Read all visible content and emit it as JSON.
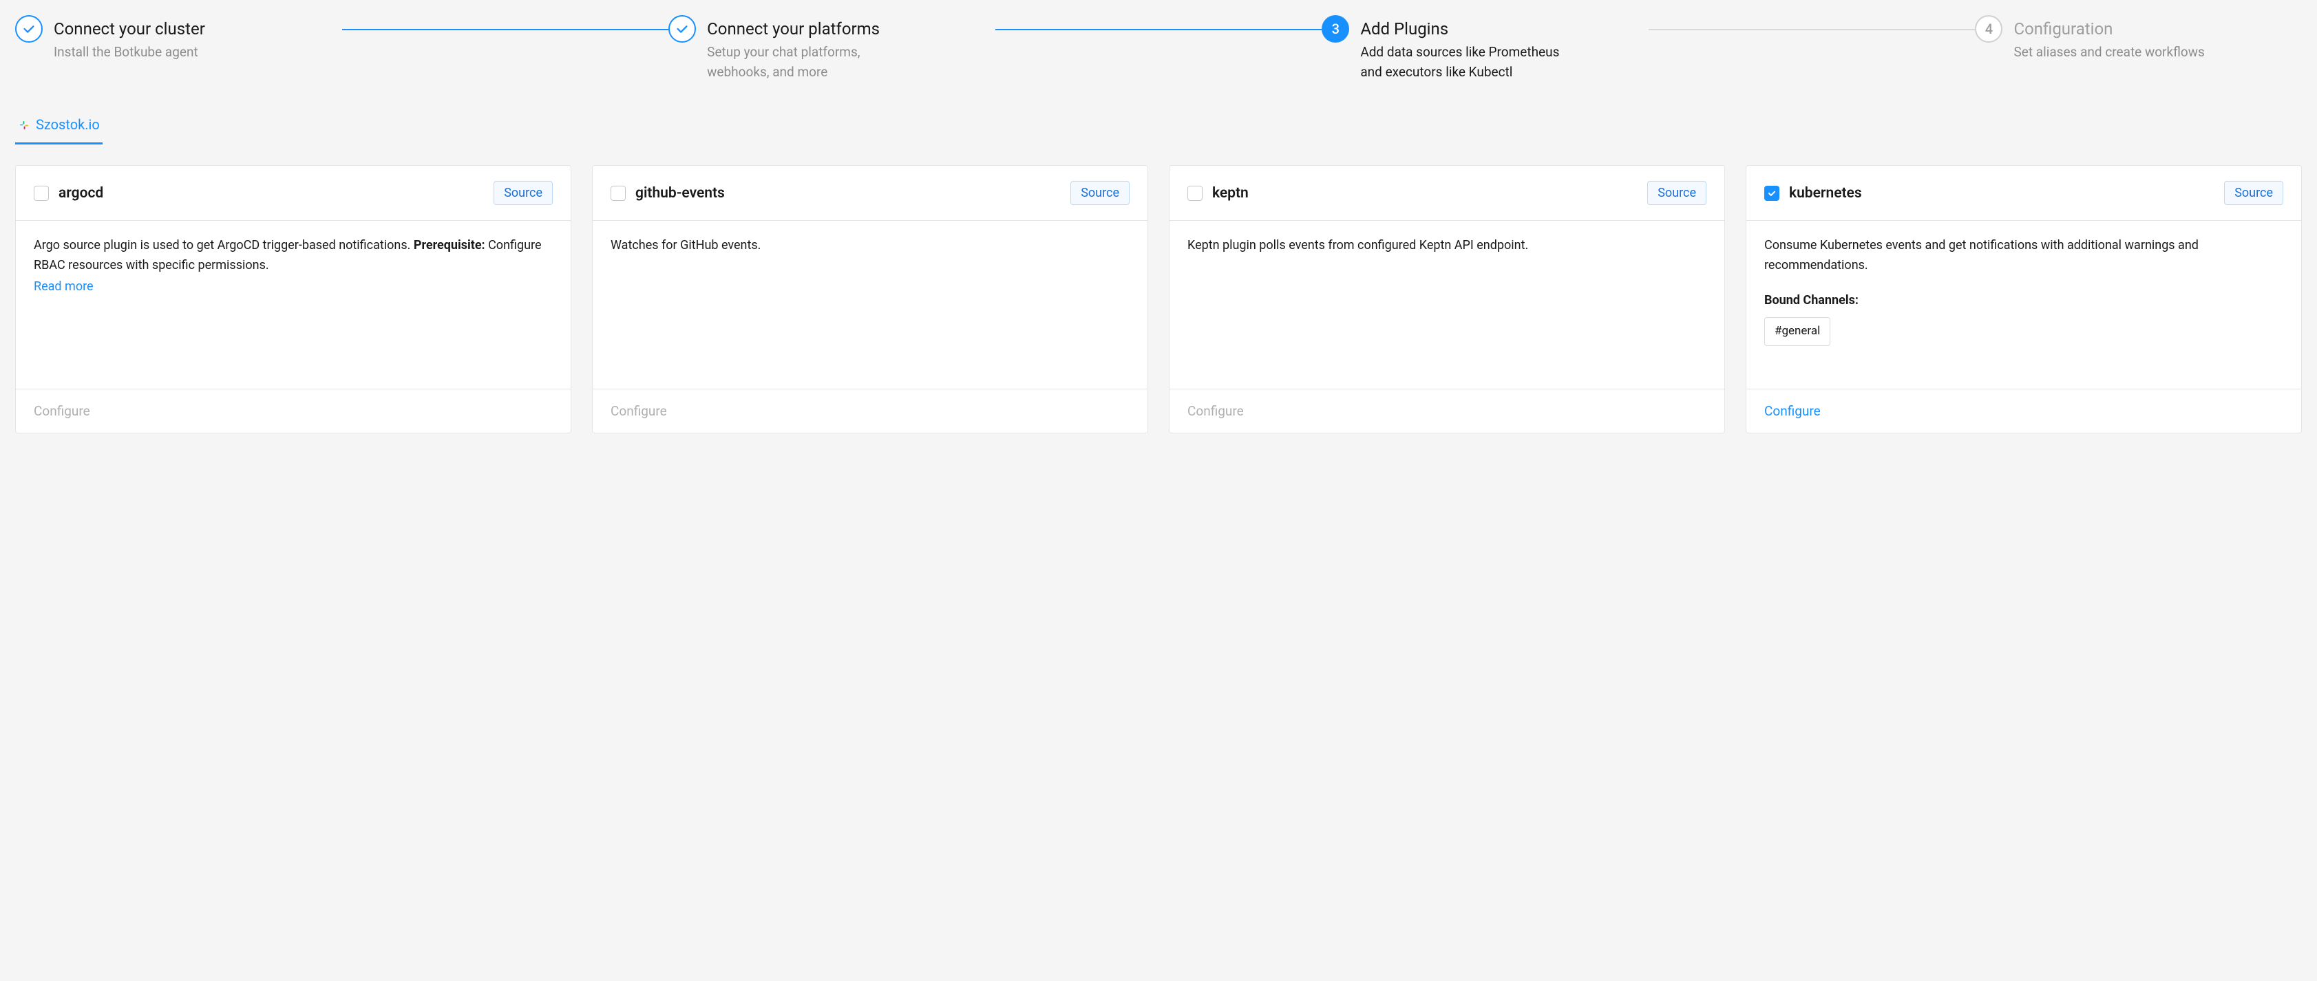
{
  "stepper": [
    {
      "title": "Connect your cluster",
      "desc": "Install the Botkube agent",
      "state": "done"
    },
    {
      "title": "Connect your platforms",
      "desc": "Setup your chat platforms, webhooks, and more",
      "state": "done"
    },
    {
      "title": "Add Plugins",
      "desc": "Add data sources like Prometheus and executors like Kubectl",
      "state": "active",
      "num": "3"
    },
    {
      "title": "Configuration",
      "desc": "Set aliases and create workflows",
      "state": "pending",
      "num": "4"
    }
  ],
  "tab": {
    "label": "Szostok.io"
  },
  "badge_label": "Source",
  "configure_label": "Configure",
  "read_more_label": "Read more",
  "bound_channels_label": "Bound Channels:",
  "plugins": [
    {
      "name": "argocd",
      "checked": false,
      "desc_pre": "Argo source plugin is used to get ArgoCD trigger-based notifications. ",
      "desc_bold": "Prerequisite:",
      "desc_post": " Configure RBAC resources with specific permissions.",
      "has_read_more": true,
      "bound_channels": []
    },
    {
      "name": "github-events",
      "checked": false,
      "desc_pre": "Watches for GitHub events.",
      "desc_bold": "",
      "desc_post": "",
      "has_read_more": false,
      "bound_channels": []
    },
    {
      "name": "keptn",
      "checked": false,
      "desc_pre": "Keptn plugin polls events from configured Keptn API endpoint.",
      "desc_bold": "",
      "desc_post": "",
      "has_read_more": false,
      "bound_channels": []
    },
    {
      "name": "kubernetes",
      "checked": true,
      "desc_pre": "Consume Kubernetes events and get notifications with additional warnings and recommendations.",
      "desc_bold": "",
      "desc_post": "",
      "has_read_more": false,
      "bound_channels": [
        "#general"
      ]
    }
  ]
}
